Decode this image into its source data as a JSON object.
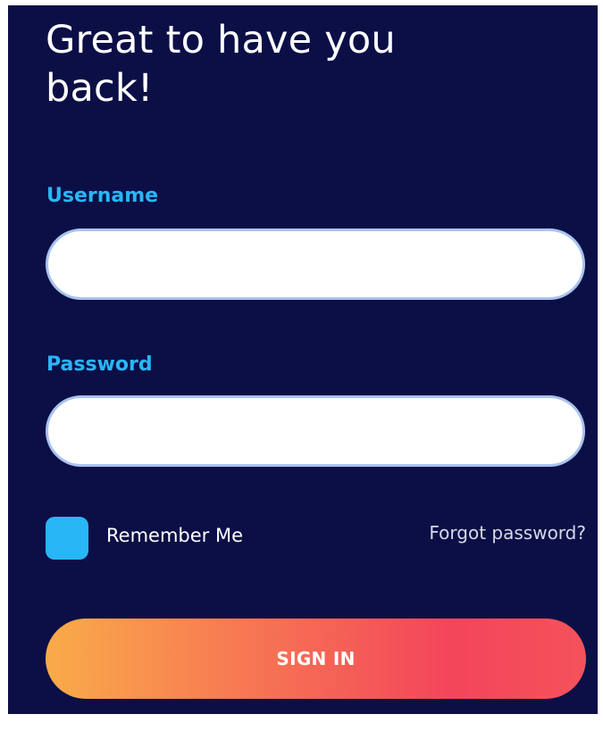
{
  "login": {
    "heading": "Great to have you back!",
    "username": {
      "label": "Username",
      "value": ""
    },
    "password": {
      "label": "Password",
      "value": ""
    },
    "remember_me": {
      "label": "Remember Me",
      "checked": false
    },
    "forgot_password": "Forgot password?",
    "sign_in": "SIGN IN"
  },
  "colors": {
    "panel_background": "#0b0f46",
    "label_accent": "#29b6f6",
    "checkbox_fill": "#29b6f6",
    "button_gradient_start": "#f9ab4a",
    "button_gradient_end": "#f3455b"
  }
}
